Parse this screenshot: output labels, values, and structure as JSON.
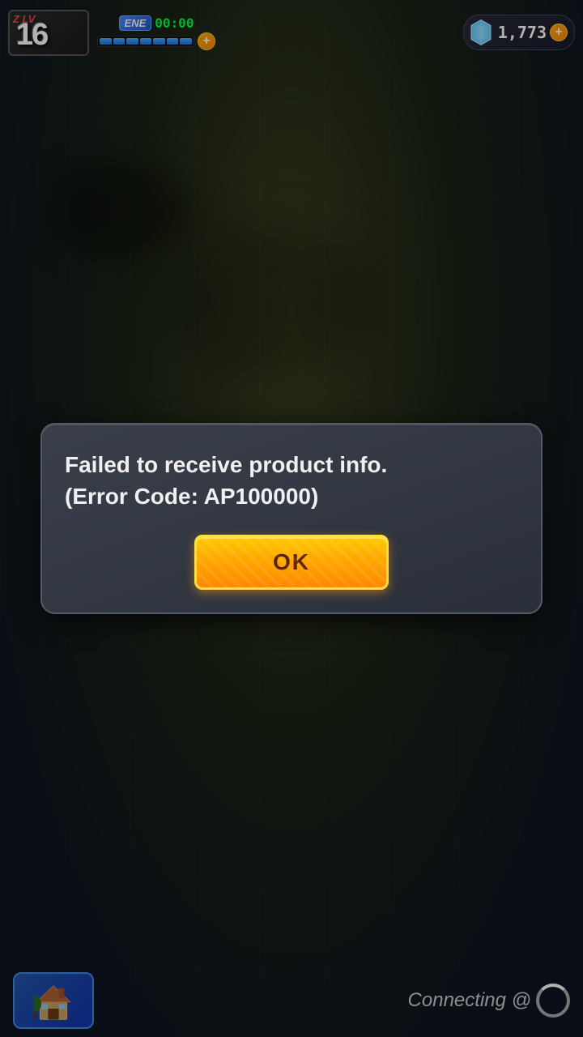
{
  "hud": {
    "level_label": "Z LV",
    "level_number": "16",
    "energy_label": "ENE",
    "timer": "00:00",
    "energy_segments": 7,
    "gem_count": "1,773",
    "plus_label": "+"
  },
  "dialog": {
    "message": "Failed to receive product info.\n(Error Code: AP100000)",
    "ok_label": "OK"
  },
  "bottom": {
    "connecting_text": "Connecting @"
  }
}
